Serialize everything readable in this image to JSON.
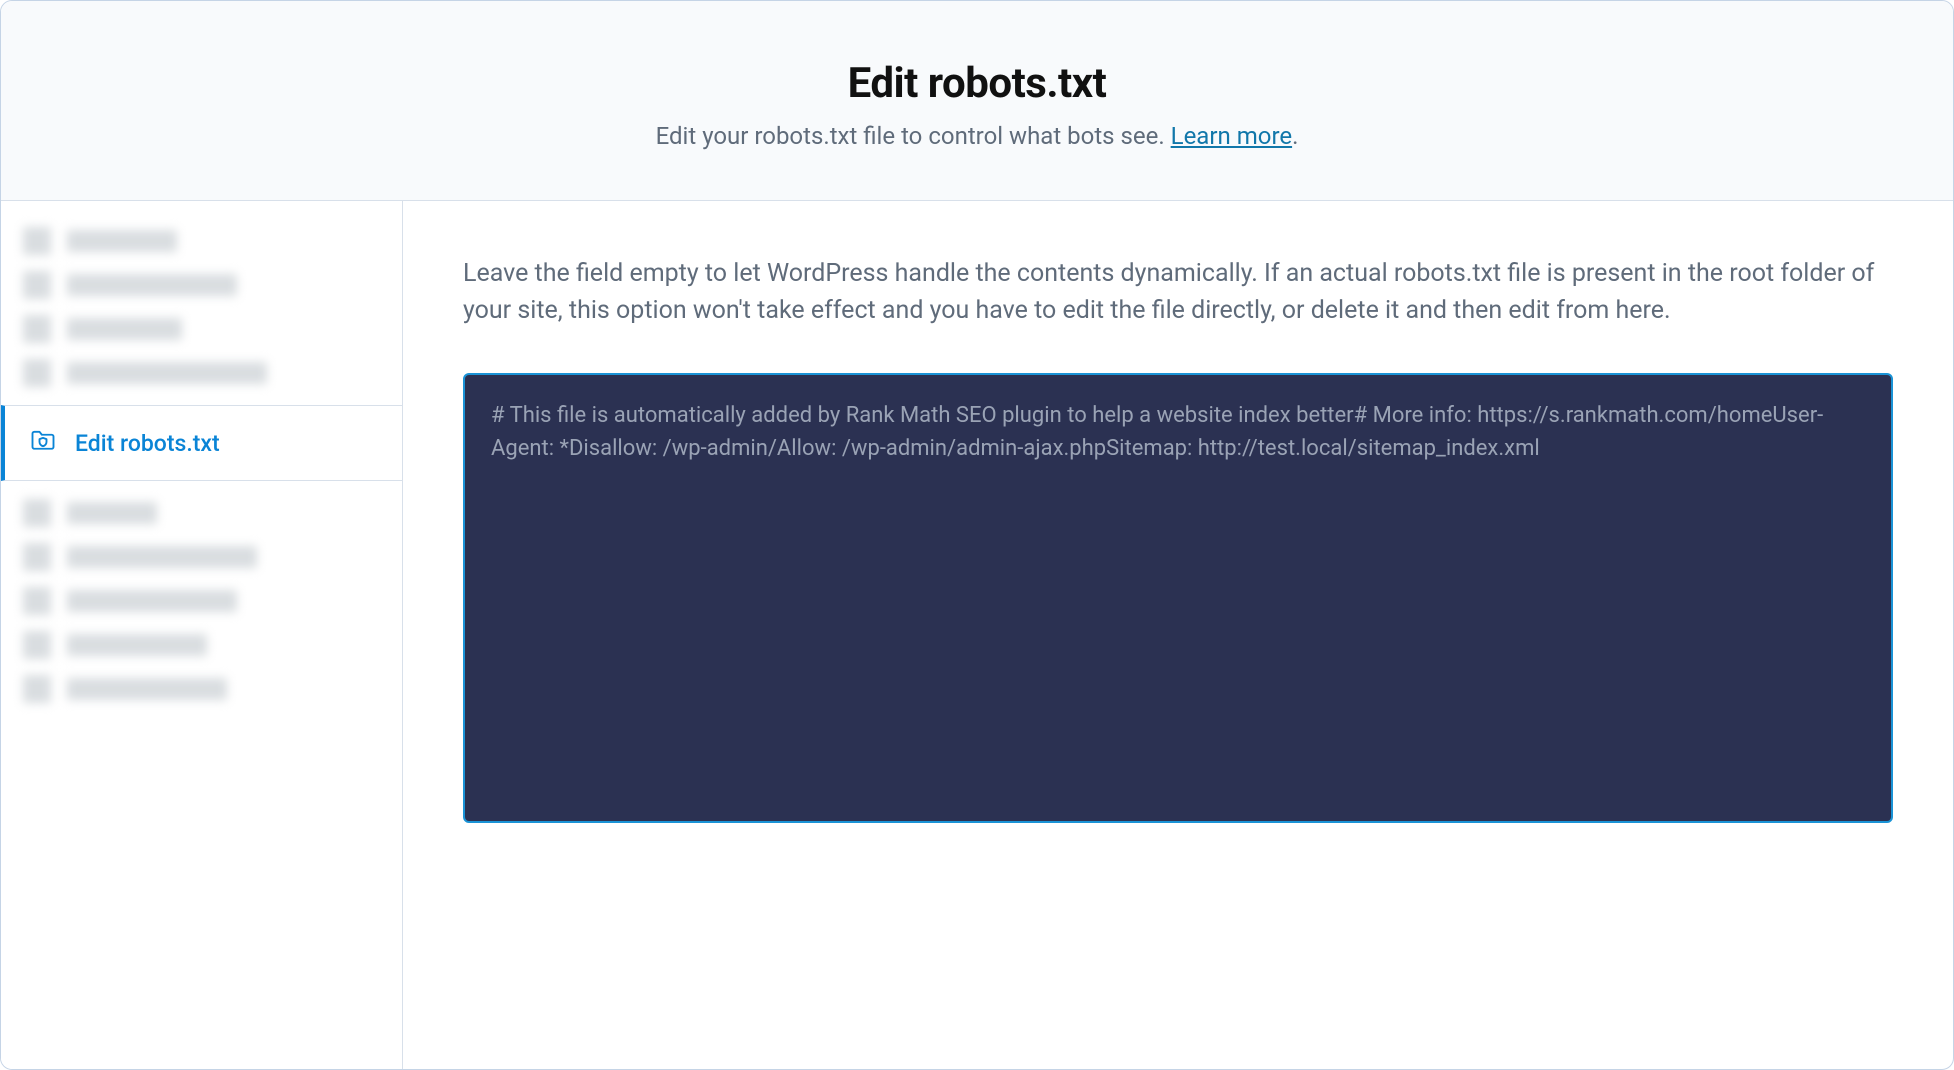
{
  "header": {
    "title": "Edit robots.txt",
    "subtitle_text": "Edit your robots.txt file to control what bots see. ",
    "learn_more_label": "Learn more",
    "subtitle_suffix": "."
  },
  "sidebar": {
    "active_item": {
      "icon": "shield-folder-icon",
      "label": "Edit robots.txt"
    }
  },
  "main": {
    "description": "Leave the field empty to let WordPress handle the contents dynamically. If an actual robots.txt file is present in the root folder of your site, this option won't take effect and you have to edit the file directly, or delete it and then edit from here.",
    "editor_placeholder": "# This file is automatically added by Rank Math SEO plugin to help a website index better# More info: https://s.rankmath.com/homeUser-Agent: *Disallow: /wp-admin/Allow: /wp-admin/admin-ajax.phpSitemap: http://test.local/sitemap_index.xml",
    "editor_value": ""
  }
}
